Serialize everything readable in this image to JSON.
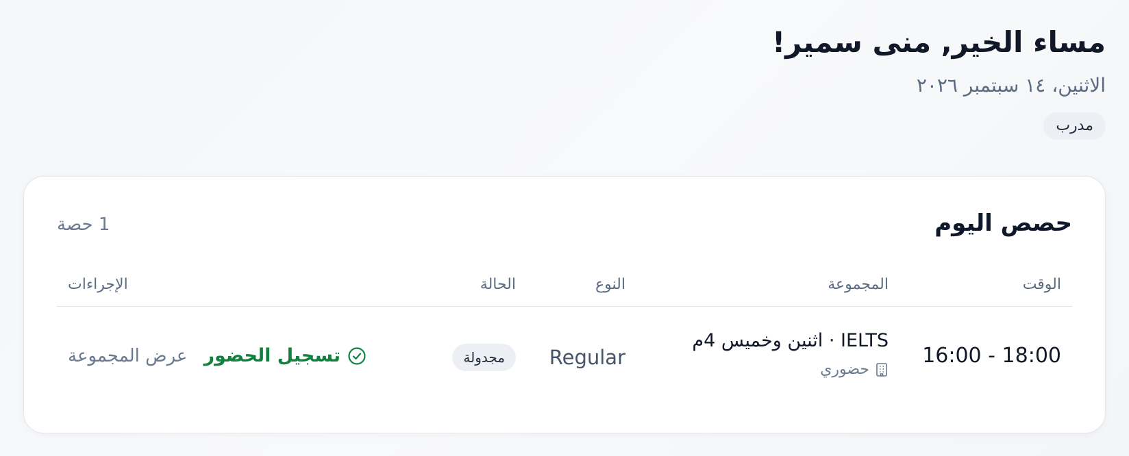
{
  "header": {
    "greeting": "مساء الخير, منى سمير!",
    "date": "الاثنين، ١٤ سبتمبر ٢٠٢٦",
    "role": "مدرب"
  },
  "today_card": {
    "title": "حصص اليوم",
    "count": "1 حصة",
    "columns": {
      "time": "الوقت",
      "group": "المجموعة",
      "type": "النوع",
      "status": "الحالة",
      "actions": "الإجراءات"
    },
    "rows": [
      {
        "time": "16:00 - 18:00",
        "group_name": "IELTS · اثنين وخميس 4م",
        "mode": "حضوري",
        "mode_icon": "building-icon",
        "type": "Regular",
        "status": "مجدولة",
        "record_attendance": "تسجيل الحضور",
        "record_attendance_icon": "check-circle-icon",
        "view_group": "عرض المجموعة"
      }
    ]
  },
  "colors": {
    "accent_green": "#12803f",
    "muted_text": "#6b7a90",
    "badge_bg": "#eceff3"
  }
}
